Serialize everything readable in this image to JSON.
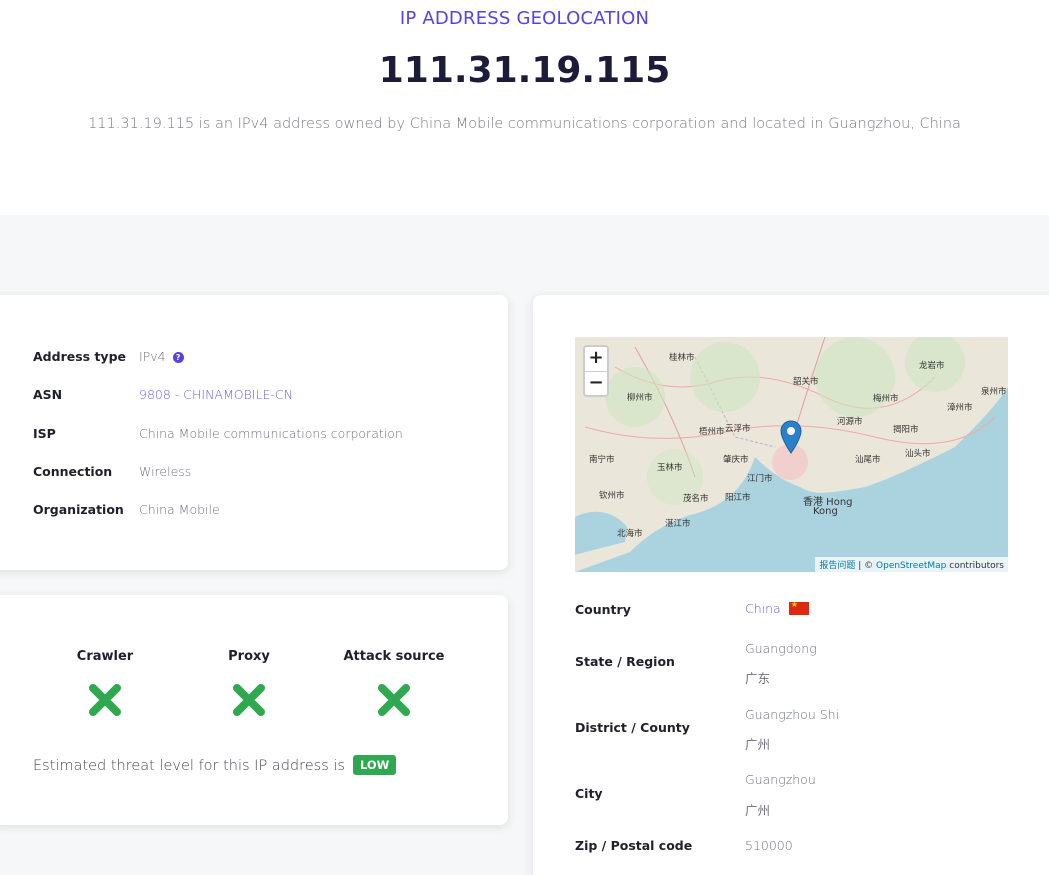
{
  "hero": {
    "eyebrow": "IP ADDRESS GEOLOCATION",
    "ip": "111.31.19.115",
    "description": "111.31.19.115 is an IPv4 address owned by China Mobile communications corporation and located in Guangzhou, China"
  },
  "info": [
    {
      "key": "Address type",
      "value": "IPv4",
      "help_icon": "question-circle-icon"
    },
    {
      "key": "ASN",
      "value": "9808 - CHINAMOBILE-CN",
      "link": true
    },
    {
      "key": "ISP",
      "value": "China Mobile communications corporation"
    },
    {
      "key": "Connection",
      "value": "Wireless"
    },
    {
      "key": "Organization",
      "value": "China Mobile"
    }
  ],
  "threat": {
    "checks": [
      {
        "label": "Crawler",
        "icon": "cross-icon"
      },
      {
        "label": "Proxy",
        "icon": "cross-icon"
      },
      {
        "label": "Attack source",
        "icon": "cross-icon"
      }
    ],
    "summary": "Estimated threat level for this IP address is",
    "level": "LOW",
    "level_color": "#2fa84f",
    "cross_color": "#2fa84f"
  },
  "map": {
    "zoom_in": "+",
    "zoom_out": "−",
    "report_link": "报告问题",
    "attribution_sep": " | © ",
    "attribution_link": "OpenStreetMap",
    "attribution_suffix": " contributors",
    "labels": {
      "hong_kong_1": "香港 Hong",
      "hong_kong_2": "Kong",
      "beihai": "北海市",
      "zhanjiang": "湛江市",
      "guilin": "桂林市",
      "shaoguan": "韶关市",
      "heyuan": "河源市",
      "meizhou": "梅州市",
      "shantou": "汕头市",
      "longyan": "龙岩市",
      "zhangzhou": "漳州市",
      "quanzhou": "泉州市",
      "nanning": "南宁市",
      "yulin": "玉林市",
      "wuzhou": "梧州市",
      "zhaoqing": "肇庆市",
      "jiangmen": "江门市",
      "yangjiang": "阳江市",
      "maoming": "茂名市",
      "qinzhou": "钦州市",
      "liuzhou": "柳州市",
      "yunfu": "云浮市",
      "shanwei": "汕尾市",
      "jieyang": "揭阳市"
    },
    "marker_color": "#2a81cb"
  },
  "geo": [
    {
      "key": "Country",
      "value": "China",
      "link": true,
      "flag": "china-flag-icon"
    },
    {
      "key": "State / Region",
      "value": "Guangdong",
      "value_local": "广东"
    },
    {
      "key": "District / County",
      "value": "Guangzhou Shi",
      "value_local": "广州"
    },
    {
      "key": "City",
      "value": "Guangzhou",
      "value_local": "广州"
    },
    {
      "key": "Zip / Postal code",
      "value": "510000"
    }
  ]
}
